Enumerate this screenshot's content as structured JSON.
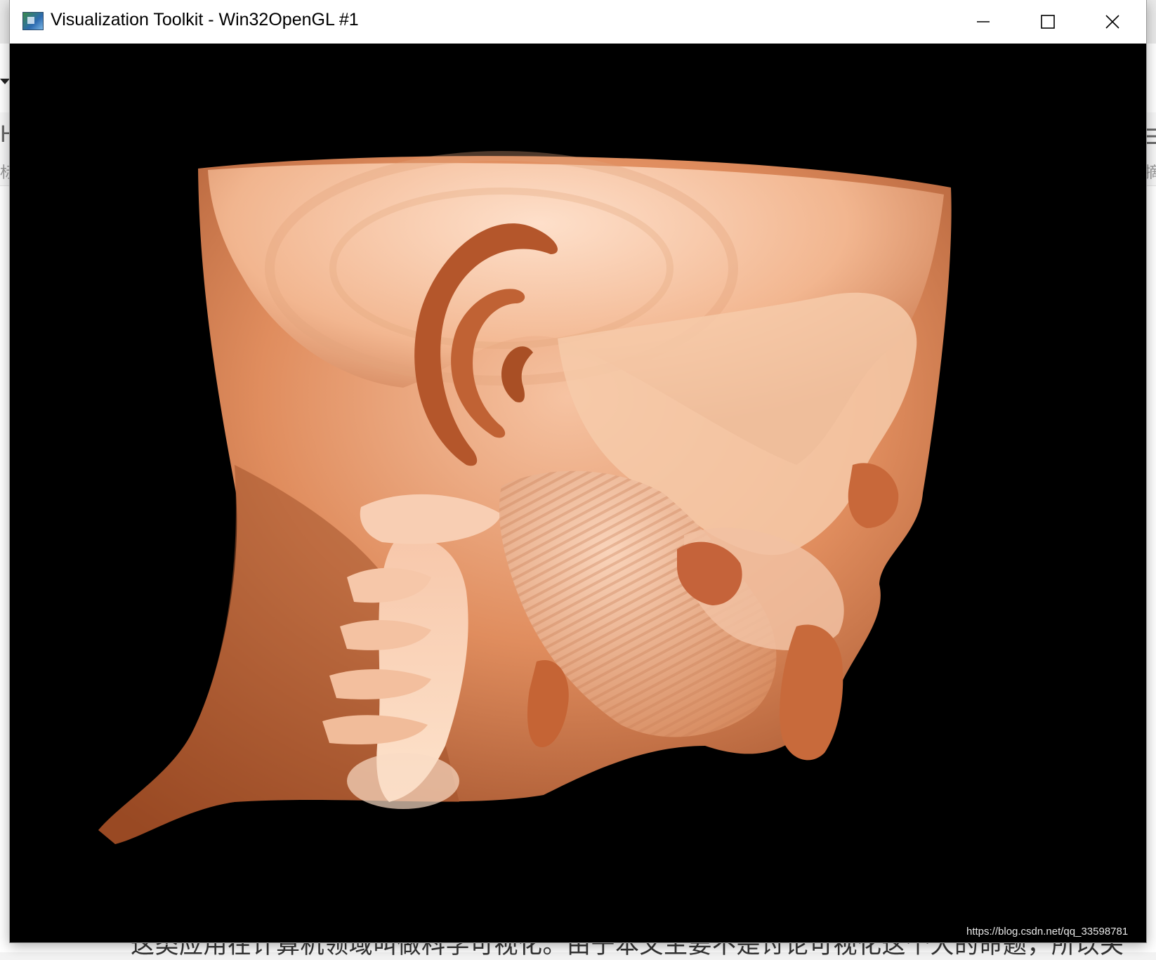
{
  "window": {
    "title": "Visualization Toolkit - Win32OpenGL #1",
    "icon": "vtk-app-icon"
  },
  "background": {
    "left_heading": "H",
    "left_sub": "标",
    "right_sub": "摘",
    "bottom_text": "这类应用在计算机领域叫做科学可视化。由于本文主要不是讨论可视化这个大的命题，所以关"
  },
  "watermark": "https://blog.csdn.net/qq_33598781",
  "colors": {
    "skin": "#c96a3e",
    "bone": "#f2c6a8",
    "background": "#000000",
    "titlebar": "#ffffff"
  }
}
